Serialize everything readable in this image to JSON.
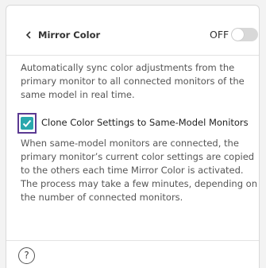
{
  "header": {
    "title": "Mirror Color",
    "toggle_state_label": "OFF"
  },
  "description": "Automatically sync color adjustments from the primary monitor to all connected monitors of the same model in real time.",
  "clone_option": {
    "label": "Clone Color Settings to Same-Model Monitors",
    "checked": true,
    "description": "When same-model monitors are connected, the primary monitor’s current color settings are copied to the others each time Mirror Color is activated. The process may take a few minutes, depending on the number of connected monitors."
  },
  "help": {
    "glyph": "?"
  },
  "colors": {
    "accent": "#2aa7ad",
    "focus_outline": "#5b3a92",
    "toggle_off": "#d8d8d8"
  },
  "icons": [
    "chevron-left-icon",
    "checkmark-icon",
    "help-icon"
  ]
}
